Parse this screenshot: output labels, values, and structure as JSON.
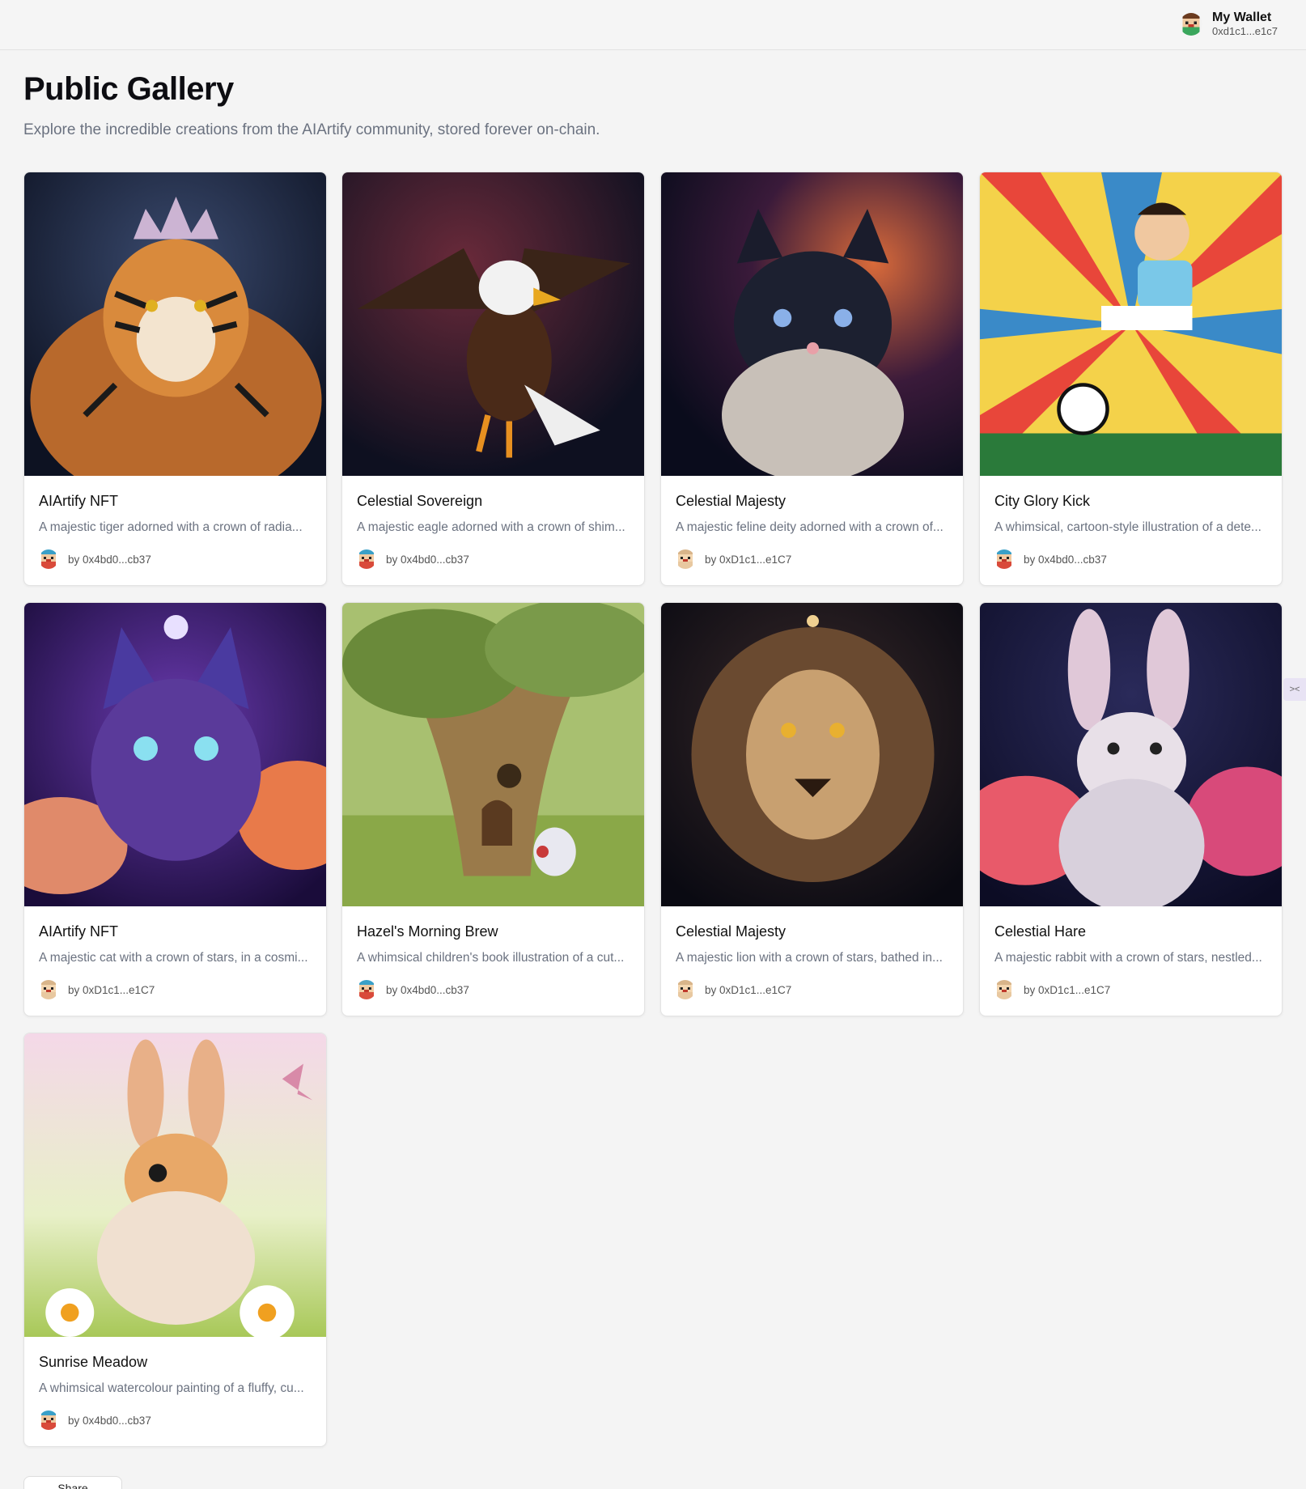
{
  "header": {
    "wallet_label": "My Wallet",
    "wallet_address": "0xd1c1...e1c7",
    "wallet_avatar": "pixel-avatar-icon"
  },
  "page": {
    "title": "Public Gallery",
    "subtitle": "Explore the incredible creations from the AIArtify community, stored forever on-chain."
  },
  "gallery": [
    {
      "title": "AIArtify NFT",
      "description": "A majestic tiger adorned with a crown of radia...",
      "author": "by 0x4bd0...cb37",
      "avatar_variant": "blue"
    },
    {
      "title": "Celestial Sovereign",
      "description": "A majestic eagle adorned with a crown of shim...",
      "author": "by 0x4bd0...cb37",
      "avatar_variant": "blue"
    },
    {
      "title": "Celestial Majesty",
      "description": "A majestic feline deity adorned with a crown of...",
      "author": "by 0xD1c1...e1C7",
      "avatar_variant": "tan"
    },
    {
      "title": "City Glory Kick",
      "description": "A whimsical, cartoon-style illustration of a dete...",
      "author": "by 0x4bd0...cb37",
      "avatar_variant": "blue"
    },
    {
      "title": "AIArtify NFT",
      "description": "A majestic cat with a crown of stars, in a cosmi...",
      "author": "by 0xD1c1...e1C7",
      "avatar_variant": "tan"
    },
    {
      "title": "Hazel's Morning Brew",
      "description": "A whimsical children's book illustration of a cut...",
      "author": "by 0x4bd0...cb37",
      "avatar_variant": "blue"
    },
    {
      "title": "Celestial Majesty",
      "description": "A majestic lion with a crown of stars, bathed in...",
      "author": "by 0xD1c1...e1C7",
      "avatar_variant": "tan"
    },
    {
      "title": "Celestial Hare",
      "description": "A majestic rabbit with a crown of stars, nestled...",
      "author": "by 0xD1c1...e1C7",
      "avatar_variant": "tan"
    },
    {
      "title": "Sunrise Meadow",
      "description": "A whimsical watercolour painting of a fluffy, cu...",
      "author": "by 0x4bd0...cb37",
      "avatar_variant": "blue"
    }
  ],
  "side_tab": {
    "icon": "collapse-arrows-icon",
    "glyph": "><"
  },
  "footer": {
    "button_label": "Share"
  }
}
